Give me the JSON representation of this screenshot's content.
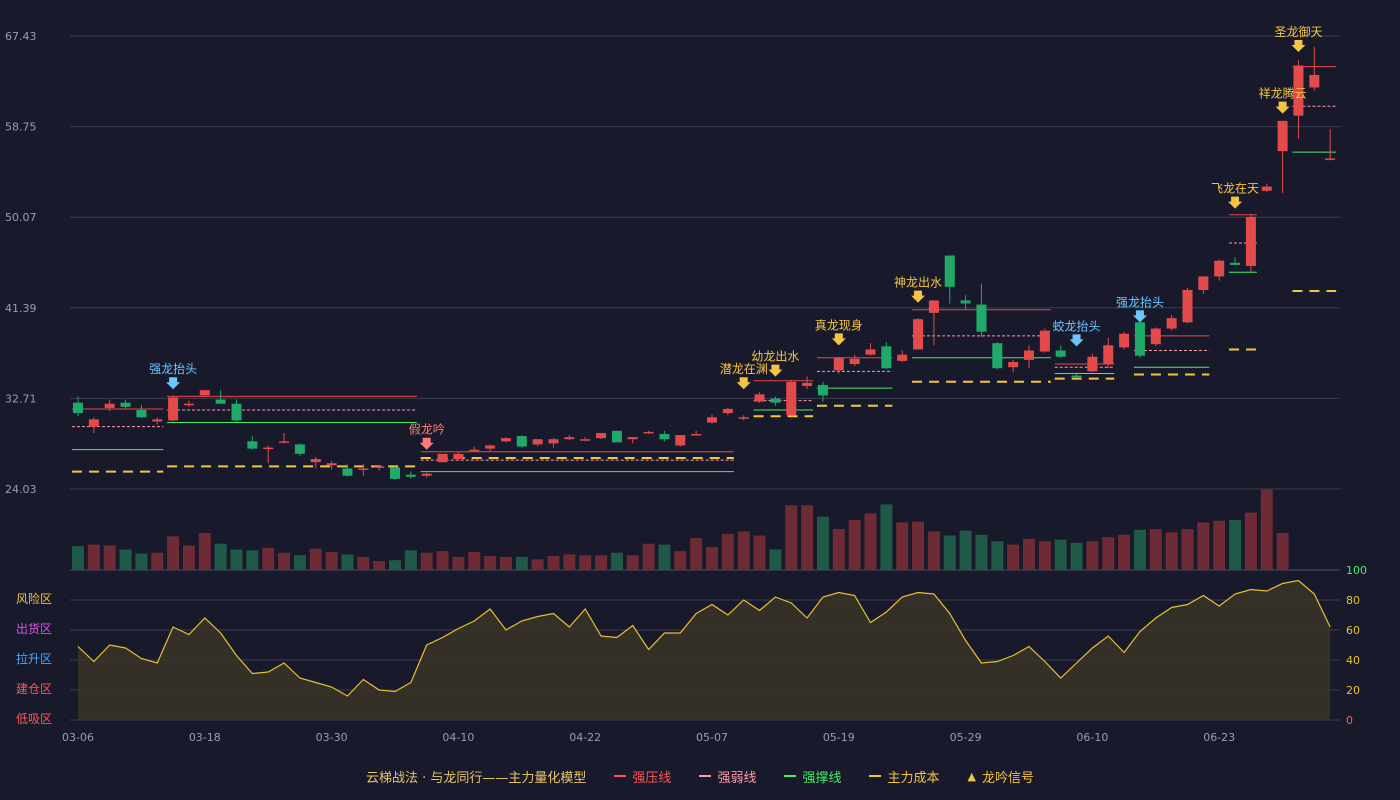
{
  "chart_data": {
    "type": "candlestick",
    "y_ticks": [
      "67.43",
      "58.75",
      "50.07",
      "41.39",
      "32.71",
      "24.03"
    ],
    "ylim": [
      24.03,
      67.43
    ],
    "x_ticks": [
      "03-06",
      "03-18",
      "03-30",
      "04-10",
      "04-22",
      "05-07",
      "05-19",
      "05-29",
      "06-10",
      "06-23"
    ],
    "candles": [
      [
        32.3,
        32.9,
        31.0,
        31.3
      ],
      [
        30.0,
        30.9,
        29.4,
        30.7
      ],
      [
        31.8,
        32.6,
        31.5,
        32.2
      ],
      [
        32.3,
        32.6,
        31.7,
        31.9
      ],
      [
        31.6,
        32.1,
        30.8,
        30.9
      ],
      [
        30.5,
        30.9,
        30.2,
        30.7
      ],
      [
        30.6,
        33.0,
        30.5,
        32.8
      ],
      [
        32.2,
        32.5,
        31.9,
        32.2
      ],
      [
        33.0,
        33.5,
        32.9,
        33.5
      ],
      [
        32.6,
        33.5,
        32.2,
        32.2
      ],
      [
        32.2,
        32.6,
        30.5,
        30.6
      ],
      [
        28.6,
        29.1,
        27.8,
        27.9
      ],
      [
        28.0,
        28.2,
        26.5,
        28.0
      ],
      [
        28.6,
        29.4,
        28.4,
        28.6
      ],
      [
        28.3,
        28.4,
        27.2,
        27.4
      ],
      [
        26.6,
        27.1,
        26.0,
        26.9
      ],
      [
        26.3,
        26.7,
        25.9,
        26.5
      ],
      [
        26.0,
        26.4,
        25.2,
        25.3
      ],
      [
        26.0,
        26.4,
        25.3,
        26.0
      ],
      [
        26.1,
        26.3,
        25.8,
        26.2
      ],
      [
        26.1,
        26.2,
        24.9,
        25.0
      ],
      [
        25.4,
        25.7,
        25.0,
        25.2
      ],
      [
        25.3,
        25.6,
        25.1,
        25.5
      ],
      [
        26.6,
        27.4,
        26.6,
        27.4
      ],
      [
        26.9,
        27.6,
        26.7,
        27.4
      ],
      [
        27.8,
        28.1,
        27.6,
        27.8
      ],
      [
        27.9,
        28.3,
        27.6,
        28.2
      ],
      [
        28.6,
        29.0,
        28.5,
        28.9
      ],
      [
        29.1,
        29.2,
        28.0,
        28.1
      ],
      [
        28.3,
        28.8,
        28.1,
        28.8
      ],
      [
        28.4,
        28.9,
        28.0,
        28.8
      ],
      [
        28.8,
        29.2,
        28.7,
        29.0
      ],
      [
        28.8,
        29.0,
        28.6,
        28.8
      ],
      [
        28.9,
        29.4,
        28.8,
        29.4
      ],
      [
        29.6,
        29.6,
        28.5,
        28.5
      ],
      [
        28.8,
        29.0,
        28.4,
        29.0
      ],
      [
        29.5,
        29.6,
        29.3,
        29.5
      ],
      [
        29.3,
        29.6,
        28.6,
        28.8
      ],
      [
        28.2,
        29.2,
        28.1,
        29.2
      ],
      [
        29.3,
        29.6,
        29.2,
        29.3
      ],
      [
        30.4,
        31.2,
        30.3,
        30.9
      ],
      [
        31.3,
        31.8,
        31.1,
        31.7
      ],
      [
        30.9,
        31.1,
        30.6,
        30.9
      ],
      [
        32.4,
        33.3,
        32.3,
        33.1
      ],
      [
        32.7,
        32.9,
        32.0,
        32.3
      ],
      [
        31.1,
        34.5,
        31.1,
        34.3
      ],
      [
        33.9,
        34.8,
        33.6,
        34.2
      ],
      [
        34.0,
        34.3,
        32.4,
        33.0
      ],
      [
        35.4,
        36.7,
        35.1,
        36.6
      ],
      [
        36.0,
        36.9,
        35.8,
        36.5
      ],
      [
        36.9,
        38.0,
        36.8,
        37.4
      ],
      [
        37.7,
        38.1,
        35.5,
        35.6
      ],
      [
        36.3,
        37.3,
        36.2,
        36.9
      ],
      [
        37.4,
        40.4,
        37.4,
        40.3
      ],
      [
        40.9,
        42.0,
        37.8,
        42.1
      ],
      [
        46.4,
        46.4,
        41.8,
        43.4
      ],
      [
        42.1,
        42.6,
        41.2,
        41.8
      ],
      [
        41.7,
        43.7,
        38.6,
        39.1
      ],
      [
        38.0,
        38.1,
        35.5,
        35.6
      ],
      [
        35.7,
        36.4,
        35.2,
        36.2
      ],
      [
        36.4,
        37.8,
        35.6,
        37.3
      ],
      [
        37.2,
        39.4,
        37.1,
        39.2
      ],
      [
        37.3,
        37.8,
        36.6,
        36.7
      ],
      [
        34.9,
        35.2,
        34.7,
        34.8
      ],
      [
        35.3,
        37.0,
        35.2,
        36.7
      ],
      [
        36.0,
        38.5,
        35.6,
        37.8
      ],
      [
        37.6,
        39.1,
        37.4,
        38.9
      ],
      [
        40.0,
        40.3,
        36.6,
        36.8
      ],
      [
        37.9,
        39.5,
        37.7,
        39.4
      ],
      [
        39.4,
        40.7,
        39.2,
        40.4
      ],
      [
        40.0,
        43.3,
        39.9,
        43.1
      ],
      [
        43.1,
        44.2,
        42.7,
        44.4
      ],
      [
        44.4,
        46.0,
        44.0,
        45.9
      ],
      [
        45.7,
        46.2,
        45.5,
        45.5
      ],
      [
        45.4,
        50.3,
        44.8,
        50.1
      ],
      [
        52.6,
        53.3,
        52.5,
        53.0
      ],
      [
        56.4,
        59.3,
        52.4,
        59.3
      ],
      [
        59.8,
        65.1,
        57.6,
        64.6
      ],
      [
        62.5,
        66.4,
        62.2,
        63.7
      ],
      [
        55.7,
        58.5,
        55.5,
        55.7
      ]
    ],
    "volume": [
      29,
      31,
      30,
      25,
      20,
      21,
      41,
      30,
      45,
      32,
      25,
      24,
      27,
      21,
      18,
      26,
      22,
      19,
      16,
      11,
      12,
      24,
      21,
      23,
      16,
      22,
      17,
      16,
      16,
      13,
      17,
      19,
      18,
      18,
      21,
      18,
      32,
      31,
      23,
      39,
      28,
      44,
      47,
      42,
      25,
      79,
      79,
      65,
      50,
      61,
      69,
      80,
      58,
      59,
      47,
      42,
      48,
      43,
      35,
      31,
      38,
      35,
      37,
      33,
      35,
      40,
      43,
      49,
      50,
      46,
      50,
      58,
      60,
      61,
      70,
      98,
      45
    ],
    "oscillator": [
      49,
      39,
      50,
      48,
      41,
      38,
      62,
      57,
      68,
      58,
      43,
      31,
      32,
      38,
      28,
      25,
      22,
      16,
      27,
      20,
      19,
      25,
      50,
      55,
      61,
      66,
      74,
      60,
      66,
      69,
      71,
      62,
      74,
      56,
      55,
      63,
      47,
      58,
      58,
      71,
      77,
      70,
      80,
      73,
      82,
      78,
      68,
      82,
      85,
      83,
      65,
      72,
      82,
      85,
      84,
      71,
      53,
      38,
      39,
      43,
      49,
      39,
      28,
      38,
      48,
      56,
      45,
      59,
      68,
      75,
      77,
      83,
      76,
      84,
      87,
      86,
      91,
      93,
      84,
      62
    ],
    "osc_ylim": [
      0,
      100
    ],
    "osc_ticks": [
      "100",
      "80",
      "60",
      "40",
      "20",
      "0"
    ],
    "zones": [
      {
        "label": "风险区",
        "color": "#f0c040"
      },
      {
        "label": "出货区",
        "color": "#e050e0"
      },
      {
        "label": "拉升区",
        "color": "#4aa8ff"
      },
      {
        "label": "建仓区",
        "color": "#ff5555"
      },
      {
        "label": "低吸区",
        "color": "#ff5555"
      }
    ],
    "signals": [
      {
        "i": 6,
        "label": "强龙抬头",
        "color": "#6ec6ff",
        "price": 33.4
      },
      {
        "i": 22,
        "label": "假龙吟",
        "color": "#ff7a7a",
        "price": 27.6
      },
      {
        "i": 42,
        "label": "潜龙在渊",
        "color": "#f5c542",
        "price": 33.4
      },
      {
        "i": 44,
        "label": "幼龙出水",
        "color": "#f5c542",
        "price": 34.6
      },
      {
        "i": 48,
        "label": "真龙现身",
        "color": "#f5c542",
        "price": 37.6
      },
      {
        "i": 53,
        "label": "神龙出水",
        "color": "#f5c542",
        "price": 41.7
      },
      {
        "i": 63,
        "label": "蛟龙抬头",
        "color": "#6ec6ff",
        "price": 37.5
      },
      {
        "i": 67,
        "label": "强龙抬头",
        "color": "#6ec6ff",
        "price": 39.8
      },
      {
        "i": 73,
        "label": "飞龙在天",
        "color": "#f5c542",
        "price": 50.7
      },
      {
        "i": 76,
        "label": "祥龙腾云",
        "color": "#f5c542",
        "price": 59.8
      },
      {
        "i": 77,
        "label": "圣龙御天",
        "color": "#f5c542",
        "price": 65.7
      }
    ],
    "levels": [
      {
        "from": 0,
        "to": 5,
        "strong": 31.7,
        "weak": 30.0,
        "support": 27.8,
        "cost": 25.7
      },
      {
        "from": 6,
        "to": 21,
        "strong": 32.9,
        "weak": 31.6,
        "support": 30.4,
        "cost": 26.2
      },
      {
        "from": 22,
        "to": 41,
        "strong": 27.6,
        "weak": 26.8,
        "support": 25.7,
        "cost": 27.0
      },
      {
        "from": 43,
        "to": 46,
        "strong": 34.4,
        "weak": 32.5,
        "support": 31.6,
        "cost": 31.0
      },
      {
        "from": 47,
        "to": 51,
        "strong": 36.6,
        "weak": 35.3,
        "support": 33.7,
        "cost": 32.0
      },
      {
        "from": 53,
        "to": 61,
        "strong": 41.2,
        "weak": 38.7,
        "support": 36.6,
        "cost": 34.3
      },
      {
        "from": 62,
        "to": 65,
        "strong": 36.0,
        "weak": 35.7,
        "support": 35.1,
        "cost": 34.6
      },
      {
        "from": 67,
        "to": 71,
        "strong": 38.7,
        "weak": 37.3,
        "support": 35.7,
        "cost": 35.0
      },
      {
        "from": 73,
        "to": 74,
        "strong": 50.3,
        "weak": 47.6,
        "support": 44.8,
        "cost": 37.4
      },
      {
        "from": 77,
        "to": 79,
        "strong": 64.5,
        "weak": 60.7,
        "support": 56.3,
        "cost": 43.0
      }
    ],
    "legend": [
      {
        "label": "强压线",
        "color": "#ff5555",
        "style": "solid"
      },
      {
        "label": "强弱线",
        "color": "#ff9aa8",
        "style": "dashed"
      },
      {
        "label": "强撑线",
        "color": "#44ee66",
        "style": "solid"
      },
      {
        "label": "主力成本",
        "color": "#f5c542",
        "style": "dashed"
      },
      {
        "label": "龙吟信号",
        "color": "#f5c542",
        "style": "triangle"
      }
    ],
    "legend_title": "云梯战法 · 与龙同行——主力量化模型",
    "colors": {
      "up": "#e34b4b",
      "down": "#1faa6a",
      "vol_up": "#6e2a35",
      "vol_down": "#1f5a48",
      "grid": "#3a3d52",
      "axis_text": "#9a9cb0",
      "osc_line": "#e8c030",
      "osc_fill": "#3a3528"
    }
  }
}
